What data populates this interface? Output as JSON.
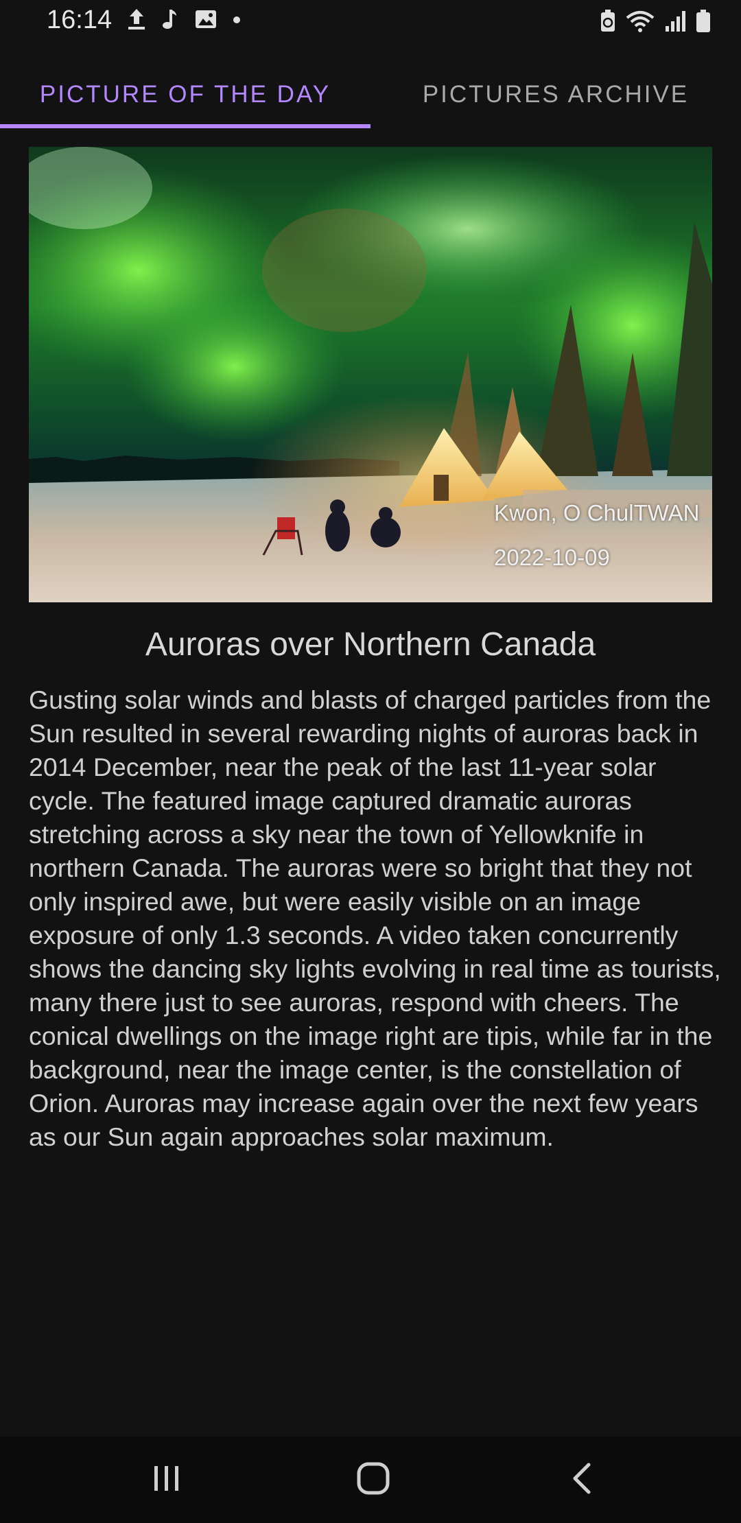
{
  "status_bar": {
    "time": "16:14",
    "left_icons": [
      "upload-icon",
      "music-note-icon",
      "image-icon",
      "dot-icon"
    ],
    "right_icons": [
      "battery-saver-icon",
      "wifi-icon",
      "signal-icon",
      "battery-icon"
    ]
  },
  "tabs": [
    {
      "label": "PICTURE OF THE DAY",
      "active": true
    },
    {
      "label": "PICTURES ARCHIVE",
      "active": false
    }
  ],
  "accent_color": "#b388ff",
  "apod": {
    "image_alt": "Auroras over tipis near Yellowknife",
    "copyright": "Kwon, O ChulTWAN",
    "date": "2022-10-09",
    "title": "Auroras over Northern Canada",
    "explanation": "Gusting solar winds and blasts of charged particles from the Sun resulted in several rewarding nights of auroras back in 2014 December, near the peak of the last 11-year solar cycle.  The featured image captured dramatic auroras stretching across a sky near the town of Yellowknife in northern Canada.  The auroras were so bright that they not only inspired awe, but were easily visible on an image exposure of only 1.3 seconds. A video taken concurrently shows the dancing sky lights evolving in real time as tourists, many there just to see auroras, respond with cheers. The conical dwellings on the image right are tipis, while far in the background, near the image center, is the constellation of Orion.  Auroras may increase again over the next few years as our Sun again approaches solar maximum."
  },
  "nav_bar": {
    "buttons": [
      "recents-icon",
      "home-icon",
      "back-icon"
    ]
  }
}
